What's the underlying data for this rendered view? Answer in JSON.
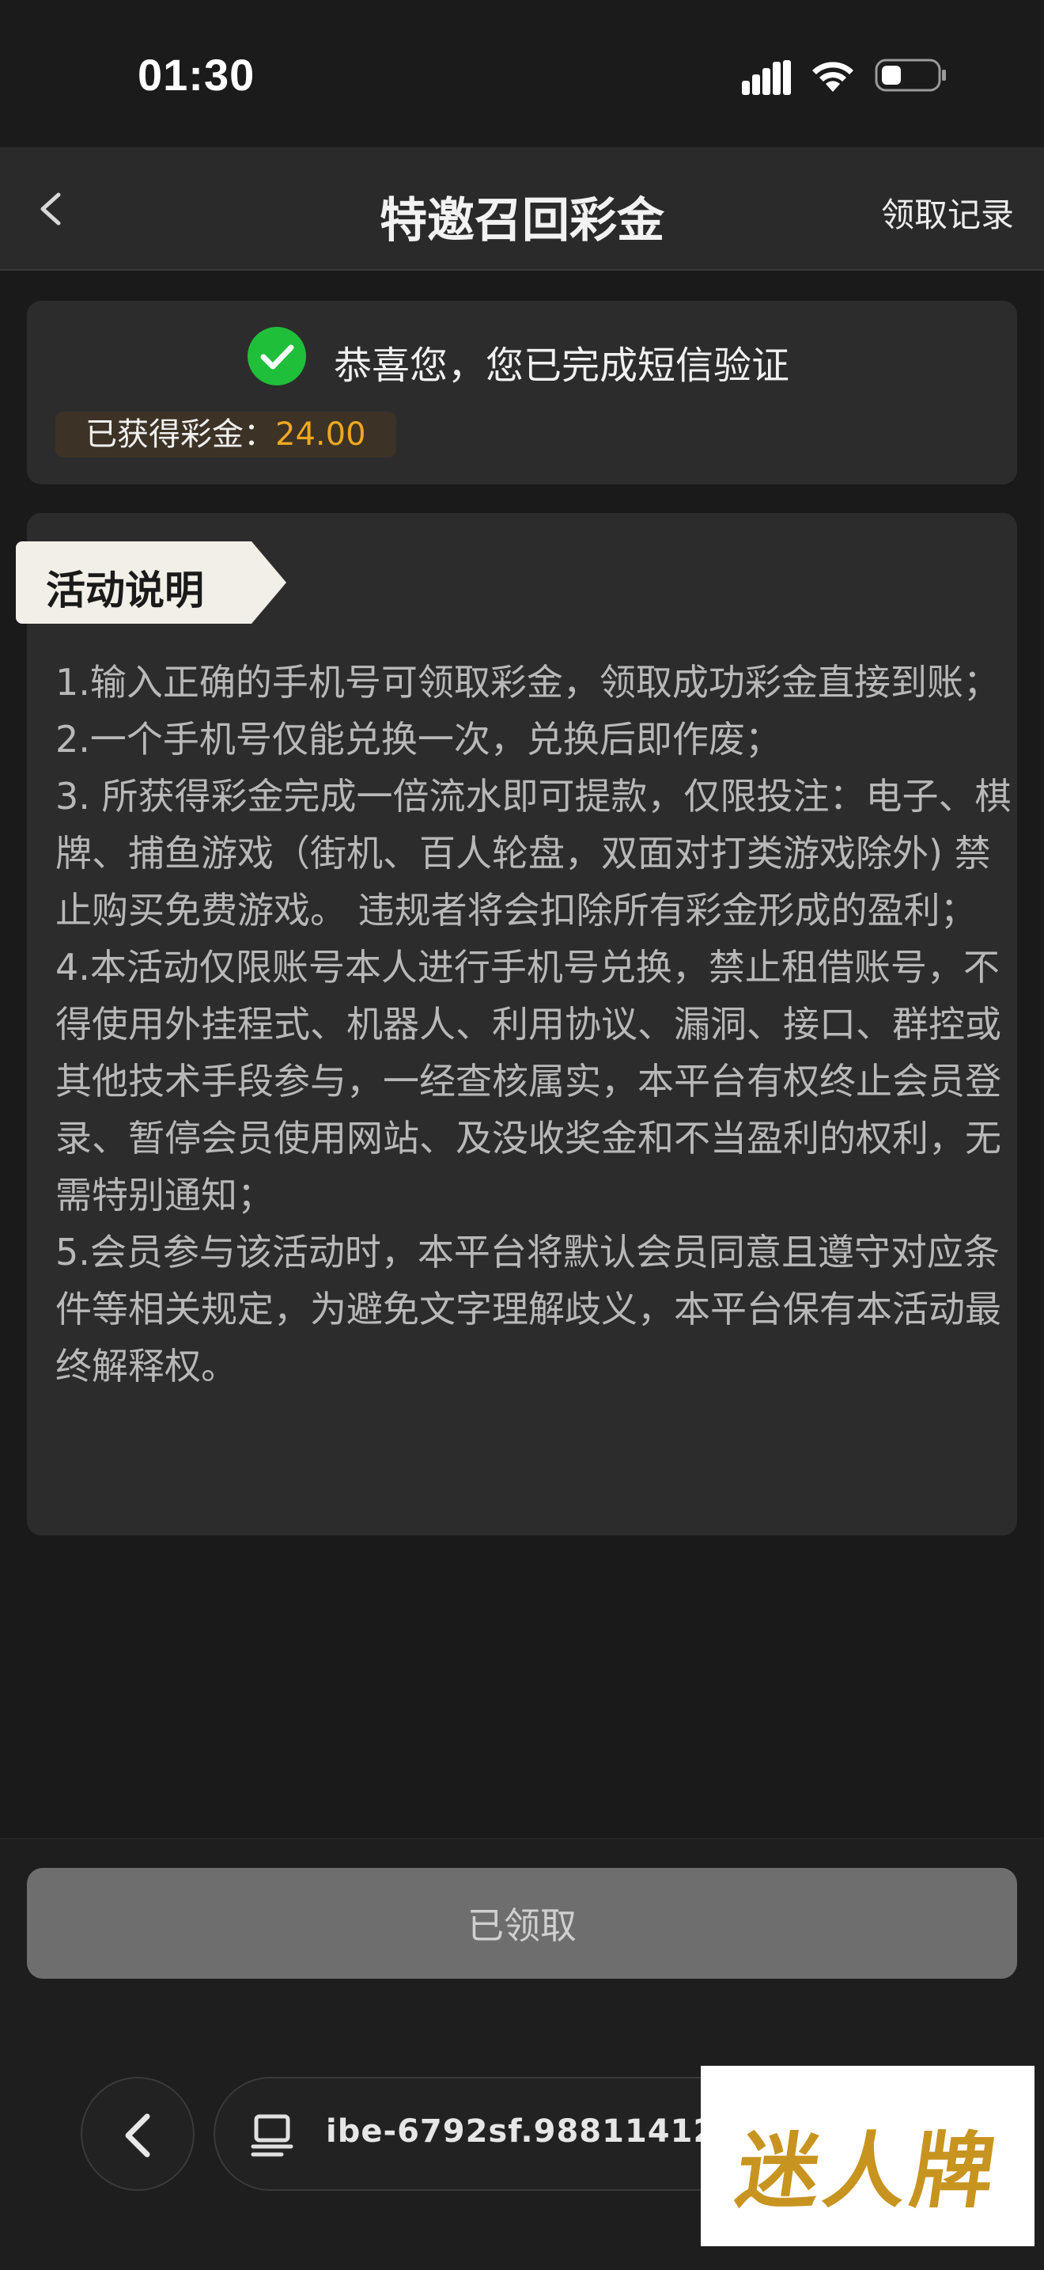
{
  "status_bar": {
    "time": "01:30"
  },
  "nav": {
    "title": "特邀召回彩金",
    "records_label": "领取记录"
  },
  "verify": {
    "message": "恭喜您，您已完成短信验证",
    "bonus_label": "已获得彩金：",
    "bonus_value": "24.00"
  },
  "info": {
    "title": "活动说明",
    "rules": [
      "1.输入正确的手机号可领取彩金，领取成功彩金直接到账；",
      "2.一个手机号仅能兑换一次，兑换后即作废；",
      "3. 所获得彩金完成一倍流水即可提款，仅限投注：电子、棋牌、捕鱼游戏（街机、百人轮盘，双面对打类游戏除外) 禁止购买免费游戏。 违规者将会扣除所有彩金形成的盈利；",
      "4.本活动仅限账号本人进行手机号兑换，禁止租借账号，不得使用外挂程式、机器人、利用协议、漏洞、接口、群控或其他技术手段参与，一经查核属实，本平台有权终止会员登录、暂停会员使用网站、及没收奖金和不当盈利的权利，无需特别通知；",
      "5.会员参与该活动时，本平台将默认会员同意且遵守对应条件等相关规定，为避免文字理解歧义，本平台保有本活动最终解释权。"
    ]
  },
  "claim_button": {
    "label": "已领取"
  },
  "browser": {
    "url": "ibe-6792sf.98811412.com"
  },
  "watermark": {
    "text": "迷人牌"
  },
  "colors": {
    "accent_gold": "#f0a820",
    "success_green": "#1fbf3a"
  },
  "icons": [
    "signal-icon",
    "wifi-icon",
    "battery-icon",
    "back-arrow-icon",
    "check-circle-icon",
    "page-icon"
  ]
}
